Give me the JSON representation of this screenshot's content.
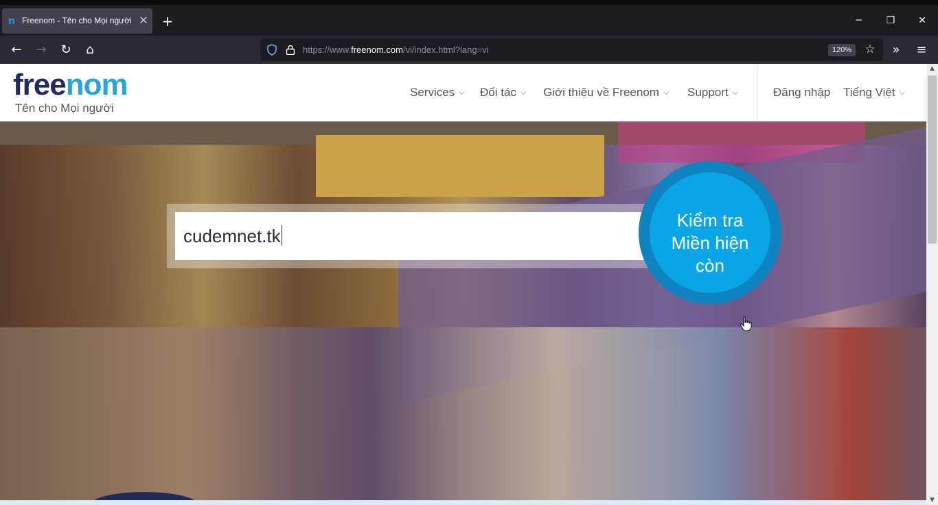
{
  "browser": {
    "tab": {
      "title": "Freenom - Tên cho Mọi người",
      "favicon_icon": "freenom-n-icon",
      "close_glyph": "✕"
    },
    "new_tab_glyph": "+",
    "window_controls": {
      "minimize": "─",
      "restore": "❐",
      "close": "✕"
    },
    "nav": {
      "back": "←",
      "forward": "→",
      "reload": "↻",
      "home": "⌂"
    },
    "url": {
      "prefix": "https://www.",
      "host": "freenom.com",
      "path": "/vi/index.html?lang=vi"
    },
    "zoom": "120%",
    "bookmark_glyph": "☆",
    "overflow_glyph": "»",
    "menu_glyph": "≡"
  },
  "site": {
    "logo": {
      "part1": "free",
      "part2": "nom",
      "tagline": "Tên cho Mọi người"
    },
    "menu": [
      {
        "label": "Services",
        "has_dropdown": true
      },
      {
        "label": "Đối tác",
        "has_dropdown": true
      },
      {
        "label": "Giới thiệu về Freenom",
        "has_dropdown": true
      },
      {
        "label": "Support",
        "has_dropdown": true
      }
    ],
    "account": {
      "login": "Đăng nhập",
      "language": "Tiếng Việt"
    },
    "hero": {
      "search_value": "cudemnet.tk",
      "check_button": [
        "Kiểm tra",
        "Miền hiện",
        "còn"
      ]
    }
  },
  "colors": {
    "brand_dark": "#1f2a5e",
    "brand_light": "#2aa3dd",
    "button_blue": "#0aa5e4",
    "button_ring": "#0f83c0"
  }
}
